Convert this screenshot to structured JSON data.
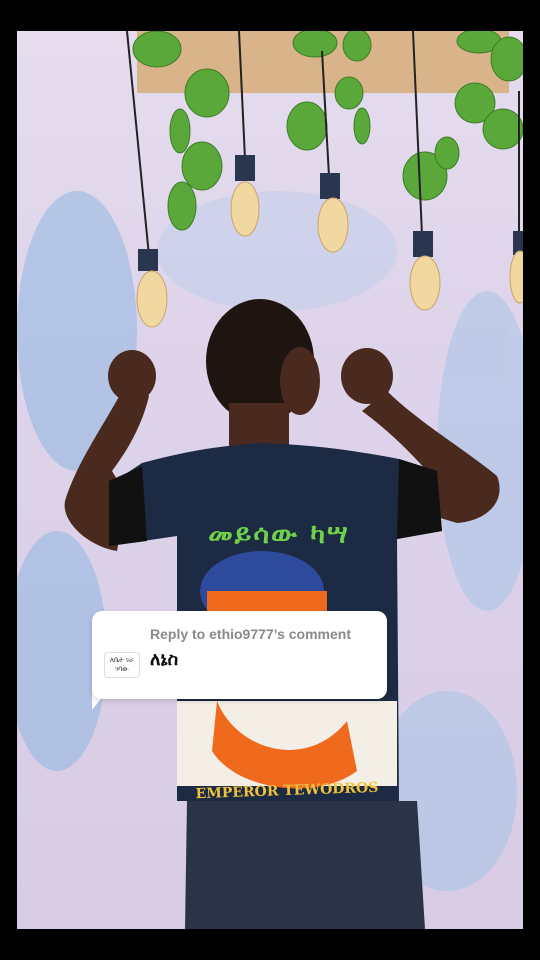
{
  "reply": {
    "header": "Reply to ethio9777’s comment",
    "comment": "ለኔስ",
    "avatar_text": "ለቤት ገራ ገባው"
  },
  "shirt": {
    "chest_text": "መይሳው ካሣ",
    "bottom_text": "EMPEROR TEWODROS"
  },
  "colors": {
    "background": "#000000",
    "wall": "#dcd2e8",
    "shirt": "#1d2a44",
    "skin": "#4a2a1e",
    "leaf": "#5aa83a",
    "card": "#ffffff"
  }
}
